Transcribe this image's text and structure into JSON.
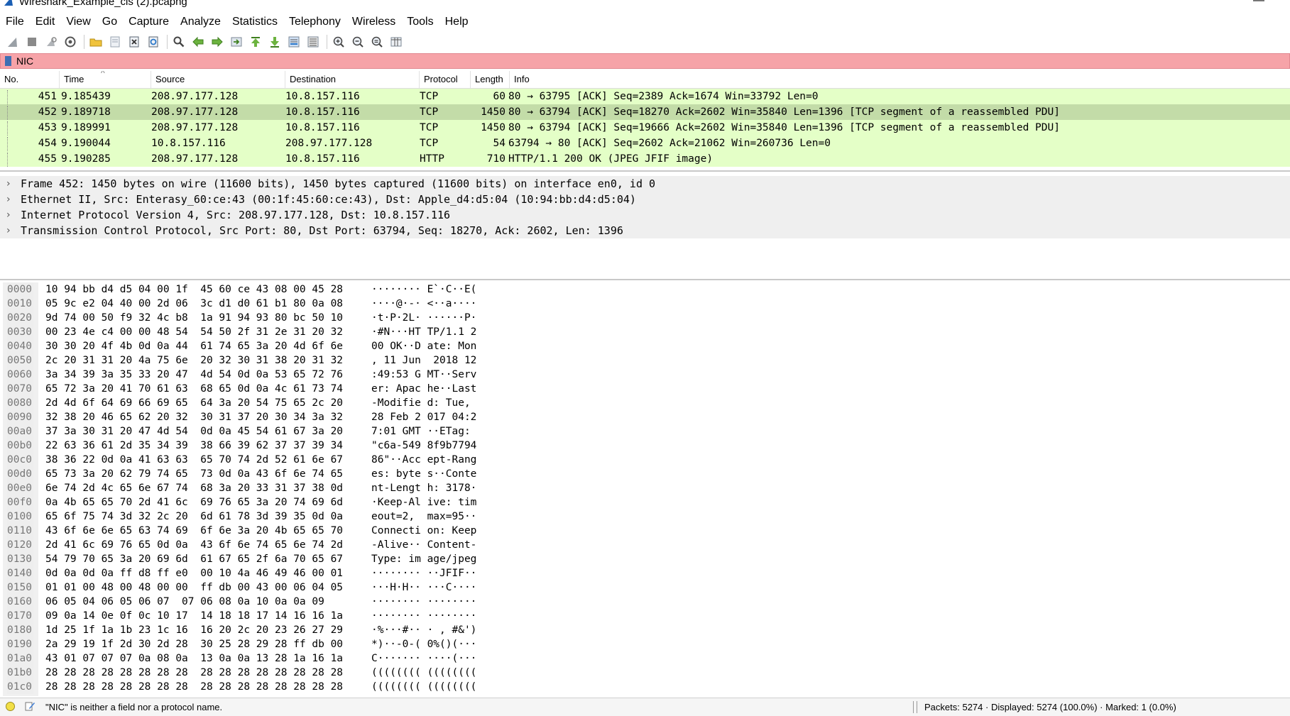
{
  "window": {
    "title": "Wireshark_Example_cis (2).pcapng",
    "minimize_glyph": "—"
  },
  "menu": [
    "File",
    "Edit",
    "View",
    "Go",
    "Capture",
    "Analyze",
    "Statistics",
    "Telephony",
    "Wireless",
    "Tools",
    "Help"
  ],
  "toolbar": {
    "icons": [
      "shark-fin-start-icon",
      "stop-capture-icon",
      "restart-capture-icon",
      "capture-options-icon",
      "open-file-icon",
      "save-file-icon",
      "close-file-icon",
      "reload-file-icon",
      "find-packet-icon",
      "go-back-icon",
      "go-forward-icon",
      "go-to-packet-icon",
      "go-first-icon",
      "go-last-icon",
      "autoscroll-icon",
      "colorize-icon",
      "zoom-in-icon",
      "zoom-out-icon",
      "zoom-normal-icon",
      "resize-columns-icon"
    ]
  },
  "filter": {
    "value": "NIC"
  },
  "packet_list": {
    "columns": [
      "No.",
      "Time",
      "Source",
      "Destination",
      "Protocol",
      "Length",
      "Info"
    ],
    "sort_indicator": "^",
    "rows": [
      {
        "no": "451",
        "time": "9.185439",
        "src": "208.97.177.128",
        "dst": "10.8.157.116",
        "proto": "TCP",
        "len": "60",
        "info": "80 → 63795 [ACK] Seq=2389 Ack=1674 Win=33792 Len=0",
        "selected": false
      },
      {
        "no": "452",
        "time": "9.189718",
        "src": "208.97.177.128",
        "dst": "10.8.157.116",
        "proto": "TCP",
        "len": "1450",
        "info": "80 → 63794 [ACK] Seq=18270 Ack=2602 Win=35840 Len=1396 [TCP segment of a reassembled PDU]",
        "selected": true
      },
      {
        "no": "453",
        "time": "9.189991",
        "src": "208.97.177.128",
        "dst": "10.8.157.116",
        "proto": "TCP",
        "len": "1450",
        "info": "80 → 63794 [ACK] Seq=19666 Ack=2602 Win=35840 Len=1396 [TCP segment of a reassembled PDU]",
        "selected": false
      },
      {
        "no": "454",
        "time": "9.190044",
        "src": "10.8.157.116",
        "dst": "208.97.177.128",
        "proto": "TCP",
        "len": "54",
        "info": "63794 → 80 [ACK] Seq=2602 Ack=21062 Win=260736 Len=0",
        "selected": false
      },
      {
        "no": "455",
        "time": "9.190285",
        "src": "208.97.177.128",
        "dst": "10.8.157.116",
        "proto": "HTTP",
        "len": "710",
        "info": "HTTP/1.1 200 OK  (JPEG JFIF image)",
        "selected": false
      }
    ]
  },
  "details": [
    "Frame 452: 1450 bytes on wire (11600 bits), 1450 bytes captured (11600 bits) on interface en0, id 0",
    "Ethernet II, Src: Enterasy_60:ce:43 (00:1f:45:60:ce:43), Dst: Apple_d4:d5:04 (10:94:bb:d4:d5:04)",
    "Internet Protocol Version 4, Src: 208.97.177.128, Dst: 10.8.157.116",
    "Transmission Control Protocol, Src Port: 80, Dst Port: 63794, Seq: 18270, Ack: 2602, Len: 1396"
  ],
  "hex_dump": [
    {
      "off": "0000",
      "hex": "10 94 bb d4 d5 04 00 1f  45 60 ce 43 08 00 45 28",
      "ascii": "········ E`·C··E("
    },
    {
      "off": "0010",
      "hex": "05 9c e2 04 40 00 2d 06  3c d1 d0 61 b1 80 0a 08",
      "ascii": "····@·-· <··a····"
    },
    {
      "off": "0020",
      "hex": "9d 74 00 50 f9 32 4c b8  1a 91 94 93 80 bc 50 10",
      "ascii": "·t·P·2L· ······P·"
    },
    {
      "off": "0030",
      "hex": "00 23 4e c4 00 00 48 54  54 50 2f 31 2e 31 20 32",
      "ascii": "·#N···HT TP/1.1 2"
    },
    {
      "off": "0040",
      "hex": "30 30 20 4f 4b 0d 0a 44  61 74 65 3a 20 4d 6f 6e",
      "ascii": "00 OK··D ate: Mon"
    },
    {
      "off": "0050",
      "hex": "2c 20 31 31 20 4a 75 6e  20 32 30 31 38 20 31 32",
      "ascii": ", 11 Jun  2018 12"
    },
    {
      "off": "0060",
      "hex": "3a 34 39 3a 35 33 20 47  4d 54 0d 0a 53 65 72 76",
      "ascii": ":49:53 G MT··Serv"
    },
    {
      "off": "0070",
      "hex": "65 72 3a 20 41 70 61 63  68 65 0d 0a 4c 61 73 74",
      "ascii": "er: Apac he··Last"
    },
    {
      "off": "0080",
      "hex": "2d 4d 6f 64 69 66 69 65  64 3a 20 54 75 65 2c 20",
      "ascii": "-Modifie d: Tue, "
    },
    {
      "off": "0090",
      "hex": "32 38 20 46 65 62 20 32  30 31 37 20 30 34 3a 32",
      "ascii": "28 Feb 2 017 04:2"
    },
    {
      "off": "00a0",
      "hex": "37 3a 30 31 20 47 4d 54  0d 0a 45 54 61 67 3a 20",
      "ascii": "7:01 GMT ··ETag: "
    },
    {
      "off": "00b0",
      "hex": "22 63 36 61 2d 35 34 39  38 66 39 62 37 37 39 34",
      "ascii": "\"c6a-549 8f9b7794"
    },
    {
      "off": "00c0",
      "hex": "38 36 22 0d 0a 41 63 63  65 70 74 2d 52 61 6e 67",
      "ascii": "86\"··Acc ept-Rang"
    },
    {
      "off": "00d0",
      "hex": "65 73 3a 20 62 79 74 65  73 0d 0a 43 6f 6e 74 65",
      "ascii": "es: byte s··Conte"
    },
    {
      "off": "00e0",
      "hex": "6e 74 2d 4c 65 6e 67 74  68 3a 20 33 31 37 38 0d",
      "ascii": "nt-Lengt h: 3178·"
    },
    {
      "off": "00f0",
      "hex": "0a 4b 65 65 70 2d 41 6c  69 76 65 3a 20 74 69 6d",
      "ascii": "·Keep-Al ive: tim"
    },
    {
      "off": "0100",
      "hex": "65 6f 75 74 3d 32 2c 20  6d 61 78 3d 39 35 0d 0a",
      "ascii": "eout=2,  max=95··"
    },
    {
      "off": "0110",
      "hex": "43 6f 6e 6e 65 63 74 69  6f 6e 3a 20 4b 65 65 70",
      "ascii": "Connecti on: Keep"
    },
    {
      "off": "0120",
      "hex": "2d 41 6c 69 76 65 0d 0a  43 6f 6e 74 65 6e 74 2d",
      "ascii": "-Alive·· Content-"
    },
    {
      "off": "0130",
      "hex": "54 79 70 65 3a 20 69 6d  61 67 65 2f 6a 70 65 67",
      "ascii": "Type: im age/jpeg"
    },
    {
      "off": "0140",
      "hex": "0d 0a 0d 0a ff d8 ff e0  00 10 4a 46 49 46 00 01",
      "ascii": "········ ··JFIF··"
    },
    {
      "off": "0150",
      "hex": "01 01 00 48 00 48 00 00  ff db 00 43 00 06 04 05",
      "ascii": "···H·H·· ···C····"
    },
    {
      "off": "0160",
      "hex": "06 05 04 06 05 06 07  07 06 08 0a 10 0a 0a 09",
      "ascii": "········ ········"
    },
    {
      "off": "0170",
      "hex": "09 0a 14 0e 0f 0c 10 17  14 18 18 17 14 16 16 1a",
      "ascii": "········ ········"
    },
    {
      "off": "0180",
      "hex": "1d 25 1f 1a 1b 23 1c 16  16 20 2c 20 23 26 27 29",
      "ascii": "·%···#·· · , #&')"
    },
    {
      "off": "0190",
      "hex": "2a 29 19 1f 2d 30 2d 28  30 25 28 29 28 ff db 00",
      "ascii": "*)··-0-( 0%()(···"
    },
    {
      "off": "01a0",
      "hex": "43 01 07 07 07 0a 08 0a  13 0a 0a 13 28 1a 16 1a",
      "ascii": "C······· ····(···"
    },
    {
      "off": "01b0",
      "hex": "28 28 28 28 28 28 28 28  28 28 28 28 28 28 28 28",
      "ascii": "(((((((( (((((((("
    },
    {
      "off": "01c0",
      "hex": "28 28 28 28 28 28 28 28  28 28 28 28 28 28 28 28",
      "ascii": "(((((((( (((((((("
    }
  ],
  "status": {
    "message": "\"NIC\" is neither a field nor a protocol name.",
    "counts": "Packets: 5274 · Displayed: 5274 (100.0%) · Marked: 1 (0.0%)"
  },
  "colors": {
    "filter_error": "#f6a3a8",
    "row_tcp": "#e4ffc7",
    "row_selected": "#c3dca8",
    "detail_bg": "#efefef"
  }
}
